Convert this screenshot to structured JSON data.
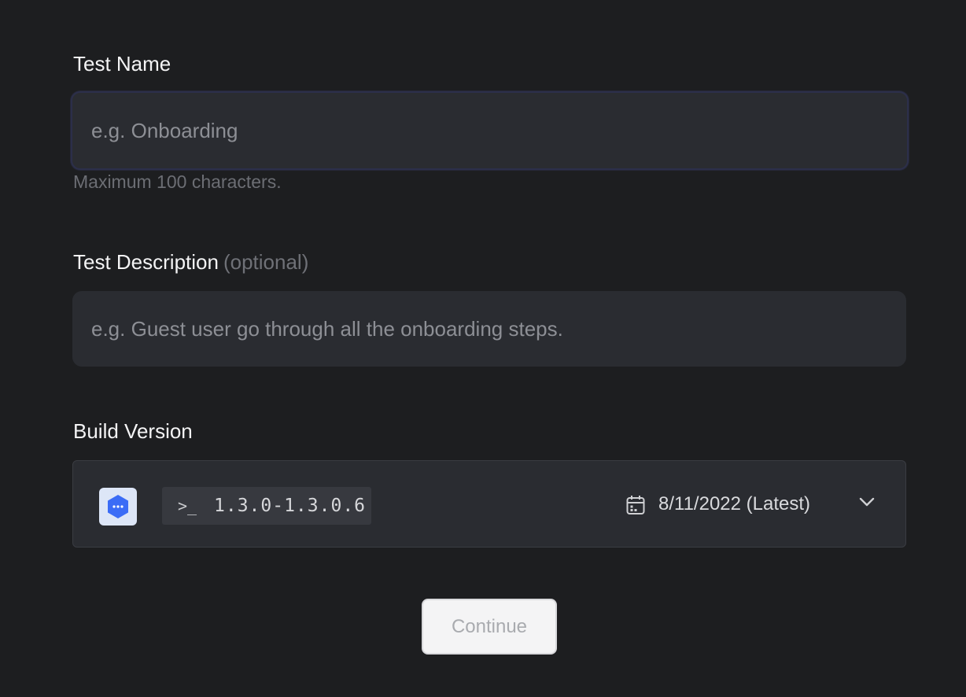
{
  "test_name": {
    "label": "Test Name",
    "placeholder": "e.g. Onboarding",
    "hint": "Maximum 100 characters."
  },
  "test_description": {
    "label": "Test Description",
    "optional_tag": "(optional)",
    "placeholder": "e.g. Guest user go through all the onboarding steps."
  },
  "build_version": {
    "label": "Build Version",
    "app_icon": "hexagon-dots-icon",
    "terminal_glyph": ">_",
    "version": "1.3.0-1.3.0.6",
    "date": "8/11/2022 (Latest)",
    "date_icon": "calendar-icon",
    "dropdown_icon": "chevron-down-icon"
  },
  "actions": {
    "continue_label": "Continue"
  },
  "colors": {
    "background": "#1d1e20",
    "field_background": "#2a2c31",
    "app_icon_accent": "#3b6cf6",
    "button_background": "#f4f4f5"
  }
}
